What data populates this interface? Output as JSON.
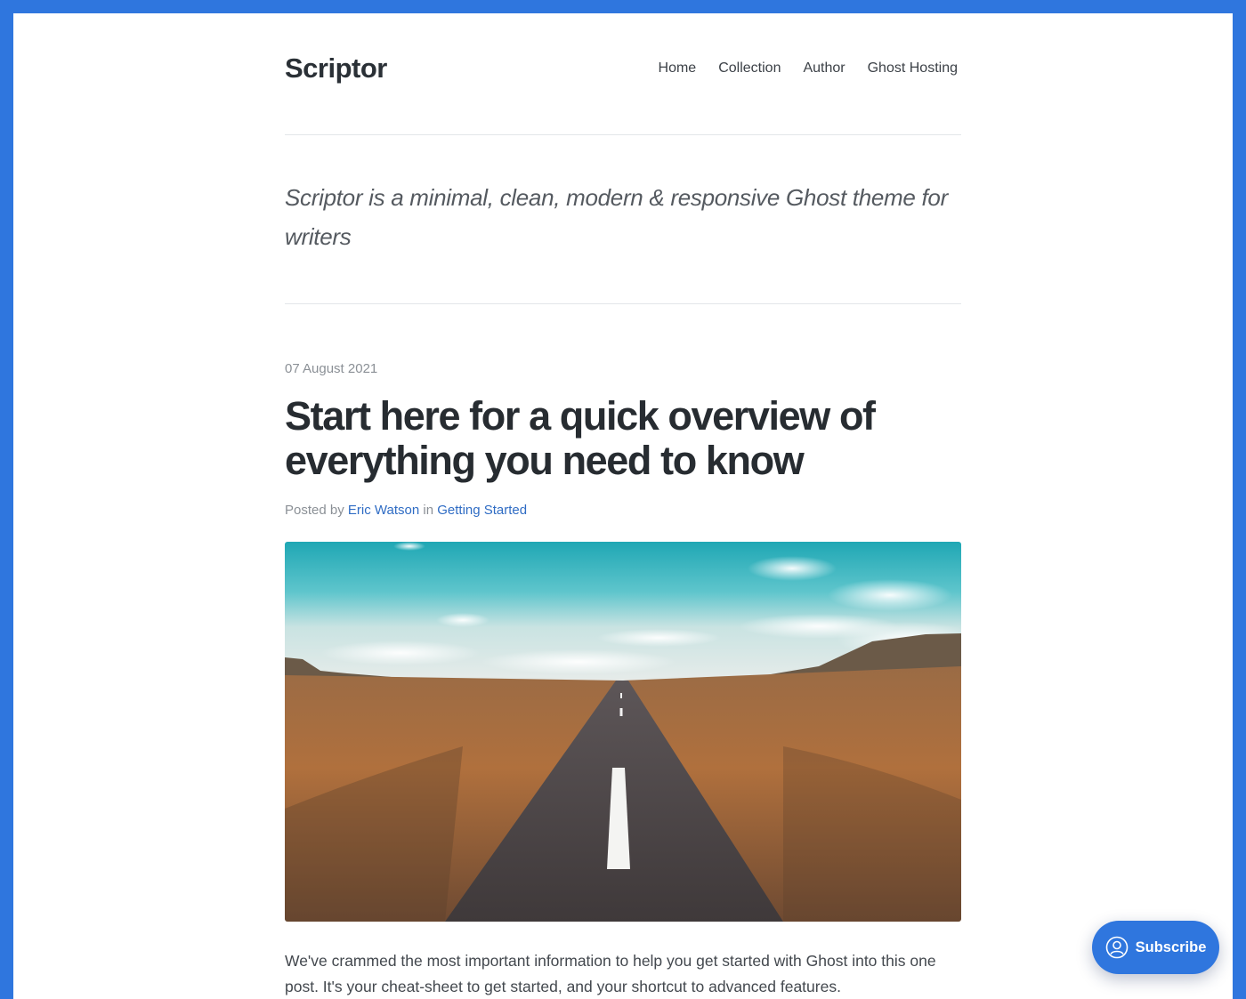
{
  "site": {
    "title": "Scriptor",
    "nav": [
      {
        "label": "Home"
      },
      {
        "label": "Collection"
      },
      {
        "label": "Author"
      },
      {
        "label": "Ghost Hosting"
      }
    ],
    "tagline": "Scriptor is a minimal, clean, modern & responsive Ghost theme for writers"
  },
  "post": {
    "date": "07 August 2021",
    "title": "Start here for a quick overview of everything you need to know",
    "meta": {
      "posted_by": "Posted by",
      "author": "Eric Watson",
      "in": "in",
      "tag": "Getting Started"
    },
    "excerpt": "We've crammed the most important information to help you get started with Ghost into this one post. It's your cheat-sheet to get started, and your shortcut to advanced features."
  },
  "subscribe": {
    "label": "Subscribe",
    "icon": "user-circle-icon"
  },
  "colors": {
    "frame": "#2f76de",
    "link": "#2f6cc4",
    "button": "#2f76de"
  }
}
